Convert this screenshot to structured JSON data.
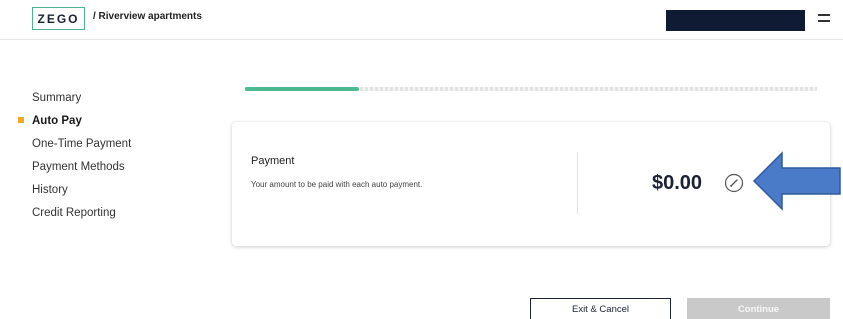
{
  "header": {
    "logo_text": "ZEGO",
    "breadcrumb": "/ Riverview apartments",
    "menu_icon": "hamburger-icon"
  },
  "sidebar": {
    "items": [
      {
        "label": "Summary",
        "active": false
      },
      {
        "label": "Auto Pay",
        "active": true
      },
      {
        "label": "One-Time Payment",
        "active": false
      },
      {
        "label": "Payment Methods",
        "active": false
      },
      {
        "label": "History",
        "active": false
      },
      {
        "label": "Credit Reporting",
        "active": false
      }
    ]
  },
  "progress": {
    "fraction": 0.2
  },
  "payment_card": {
    "title": "Payment",
    "description": "Your amount to be paid with each auto payment.",
    "amount": "$0.00",
    "edit_icon": "pencil-circle-icon"
  },
  "annotation": {
    "icon": "arrow-left-icon",
    "color": "#4a7bc8"
  },
  "footer": {
    "exit_label": "Exit & Cancel",
    "continue_label": "Continue"
  },
  "colors": {
    "brand_green": "#4cb990",
    "active_marker": "#f5a623",
    "navy": "#0f1a33",
    "disabled": "#c9c9c9"
  }
}
